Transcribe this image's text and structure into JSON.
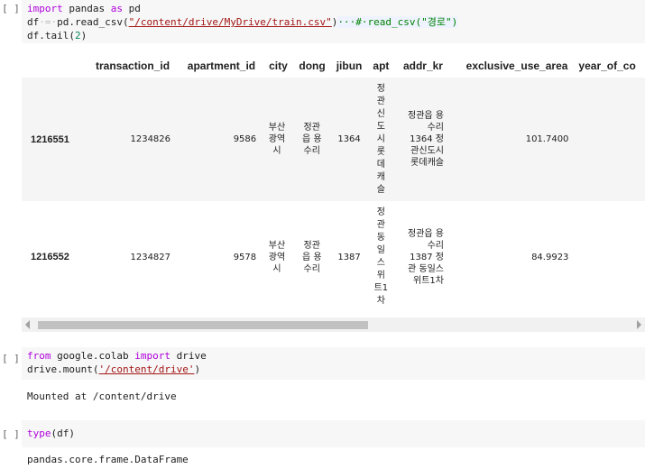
{
  "cell_marker": "[ ]",
  "cell1": {
    "line1": {
      "kw1": "import",
      "rest": " pandas ",
      "kw2": "as",
      "tail": " pd"
    },
    "line2": {
      "pre": "df",
      "eq": "·=·",
      "mid": "pd.read_csv(",
      "path": "\"/content/drive/MyDrive/train.csv\"",
      "close": ")",
      "comment": "···#·read_csv(\"경로\")"
    },
    "line3": {
      "pre": "df.tail(",
      "num": "2",
      "post": ")"
    }
  },
  "dataframe": {
    "columns": [
      "transaction_id",
      "apartment_id",
      "city",
      "dong",
      "jibun",
      "apt",
      "addr_kr",
      "exclusive_use_area",
      "year_of_co"
    ],
    "rows": [
      {
        "index": "1216551",
        "transaction_id": "1234826",
        "apartment_id": "9586",
        "city": "부산\n광역\n시",
        "dong": "정관\n읍 용\n수리",
        "jibun": "1364",
        "apt": "정\n관\n신\n도\n시\n롯\n데\n캐\n슬",
        "addr_kr": "정관읍 용\n수리\n1364 정\n관신도시\n롯데캐슬",
        "exclusive_use_area": "101.7400"
      },
      {
        "index": "1216552",
        "transaction_id": "1234827",
        "apartment_id": "9578",
        "city": "부산\n광역\n시",
        "dong": "정관\n읍 용\n수리",
        "jibun": "1387",
        "apt": "정\n관\n동\n일\n스\n위\n트1\n차",
        "addr_kr": "정관읍 용\n수리\n1387 정\n관 동일스\n위트1차",
        "exclusive_use_area": "84.9923"
      }
    ]
  },
  "cell2": {
    "line1": {
      "kw1": "from",
      "mid": " google.colab ",
      "kw2": "import",
      "tail": " drive"
    },
    "line2": {
      "pre": "drive.mount(",
      "path": "'/content/drive'",
      "post": ")"
    },
    "output": "Mounted at /content/drive"
  },
  "cell3": {
    "line1": {
      "fn": "type",
      "post": "(df)"
    },
    "output": "pandas.core.frame.DataFrame"
  }
}
